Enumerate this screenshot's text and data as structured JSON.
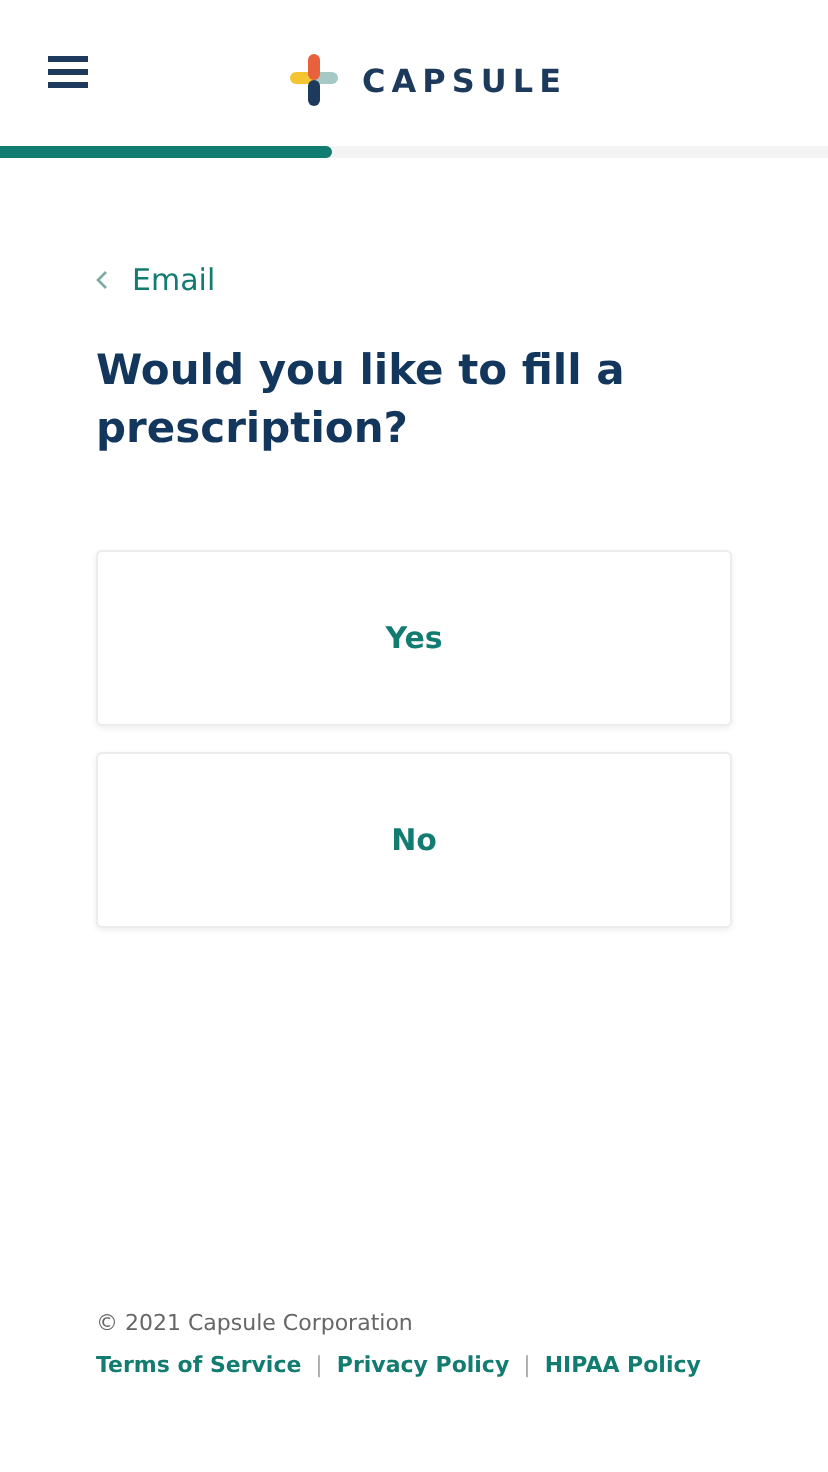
{
  "header": {
    "logo_text": "CAPSULE"
  },
  "progress": {
    "level": 0.4
  },
  "back_link": {
    "label": "Email"
  },
  "question": "Would you like to fill a prescription?",
  "options": [
    {
      "label": "Yes",
      "selected": false
    },
    {
      "label": "No",
      "selected": false
    }
  ],
  "footer": {
    "copyright": "© 2021 Capsule Corporation",
    "separator": "|",
    "links": [
      "Terms of Service",
      "Privacy Policy",
      "HIPAA Policy"
    ]
  }
}
